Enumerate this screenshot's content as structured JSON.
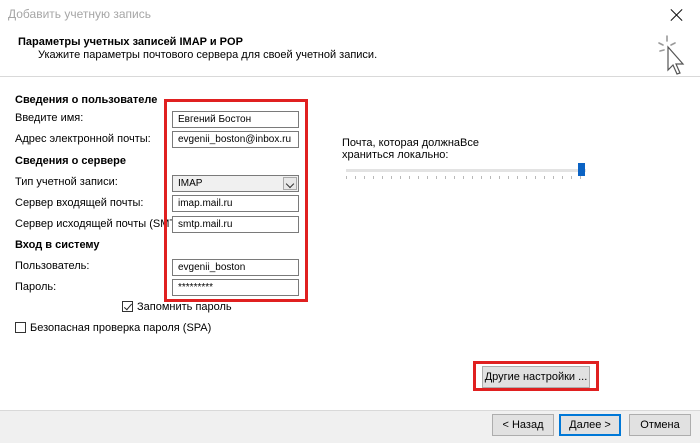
{
  "window": {
    "title": "Добавить учетную запись"
  },
  "header": {
    "title": "Параметры учетных записей IMAP и POP",
    "subtitle": "Укажите параметры почтового сервера для своей учетной записи.",
    "icon": "cursor-click-icon"
  },
  "user_info": {
    "section_title": "Сведения о пользователе",
    "name_label": "Введите имя:",
    "name_value": "Евгений Бостон",
    "email_label": "Адрес электронной почты:",
    "email_value": "evgenii_boston@inbox.ru"
  },
  "server_info": {
    "section_title": "Сведения о сервере",
    "account_type_label": "Тип учетной записи:",
    "account_type_value": "IMAP",
    "incoming_label": "Сервер входящей почты:",
    "incoming_value": "imap.mail.ru",
    "outgoing_label": "Сервер исходящей почты (SMTP):",
    "outgoing_value": "smtp.mail.ru"
  },
  "login": {
    "section_title": "Вход в систему",
    "username_label": "Пользователь:",
    "username_value": "evgenii_boston",
    "password_label": "Пароль:",
    "password_value": "*********",
    "remember_label": "Запомнить пароль",
    "remember_checked": true,
    "spa_label": "Безопасная проверка пароля (SPA)",
    "spa_checked": false
  },
  "offline": {
    "label_line1": "Почта, которая должна",
    "label_line2": "храниться локально:",
    "value": "Все"
  },
  "buttons": {
    "more_settings": "Другие настройки ...",
    "back": "< Назад",
    "next": "Далее >",
    "cancel": "Отмена"
  },
  "colors": {
    "highlight": "#e02020",
    "accent": "#0b63c4"
  }
}
